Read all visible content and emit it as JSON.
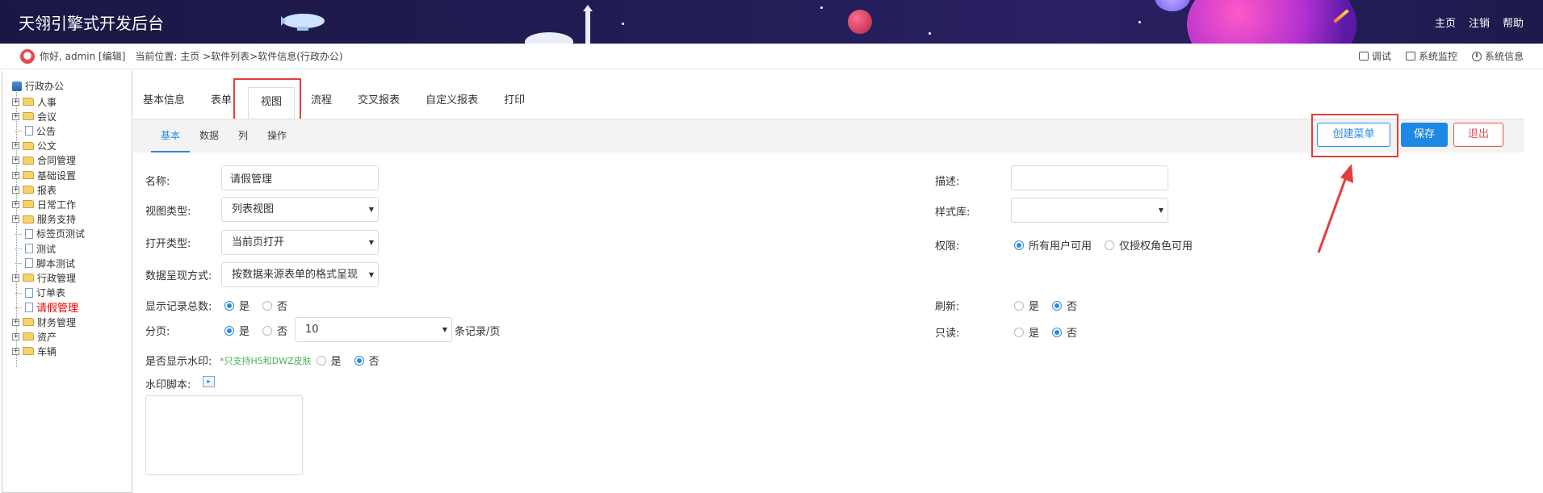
{
  "header": {
    "title": "天翎引擎式开发后台",
    "nav": [
      "主页",
      "注销",
      "帮助"
    ]
  },
  "subbar": {
    "greeting": "你好, admin [编辑]",
    "location": "当前位置: 主页 >软件列表>软件信息(行政办公)",
    "tools": [
      "调试",
      "系统监控",
      "系统信息"
    ]
  },
  "tree": {
    "root": "行政办公",
    "items": [
      {
        "label": "人事",
        "type": "folder"
      },
      {
        "label": "会议",
        "type": "folder"
      },
      {
        "label": "公告",
        "type": "doc"
      },
      {
        "label": "公文",
        "type": "folder"
      },
      {
        "label": "合同管理",
        "type": "folder"
      },
      {
        "label": "基础设置",
        "type": "folder"
      },
      {
        "label": "报表",
        "type": "folder"
      },
      {
        "label": "日常工作",
        "type": "folder"
      },
      {
        "label": "服务支持",
        "type": "folder"
      },
      {
        "label": "标签页测试",
        "type": "doc"
      },
      {
        "label": "测试",
        "type": "doc"
      },
      {
        "label": "脚本测试",
        "type": "doc"
      },
      {
        "label": "行政管理",
        "type": "folder"
      },
      {
        "label": "订单表",
        "type": "doc"
      },
      {
        "label": "请假管理",
        "type": "doc",
        "active": true
      },
      {
        "label": "财务管理",
        "type": "folder"
      },
      {
        "label": "资产",
        "type": "folder"
      },
      {
        "label": "车辆",
        "type": "folder"
      }
    ]
  },
  "tabs": [
    "基本信息",
    "表单",
    "视图",
    "流程",
    "交叉报表",
    "自定义报表",
    "打印"
  ],
  "subtabs": [
    "基本",
    "数据",
    "列",
    "操作"
  ],
  "buttons": {
    "create": "创建菜单",
    "save": "保存",
    "exit": "退出"
  },
  "form": {
    "name_label": "名称:",
    "name_value": "请假管理",
    "view_type_label": "视图类型:",
    "view_type_value": "列表视图",
    "open_type_label": "打开类型:",
    "open_type_value": "当前页打开",
    "present_label": "数据呈现方式:",
    "present_value": "按数据来源表单的格式呈现",
    "show_total_label": "显示记录总数:",
    "paging_label": "分页:",
    "page_size_value": "10",
    "page_size_suffix": "条记录/页",
    "watermark_label": "是否显示水印:",
    "watermark_hint": "*只支持H5和DWZ皮肤",
    "watermark_script_label": "水印脚本:",
    "desc_label": "描述:",
    "style_label": "样式库:",
    "perm_label": "权限:",
    "perm_all": "所有用户可用",
    "perm_role": "仅授权角色可用",
    "refresh_label": "刷新:",
    "readonly_label": "只读:",
    "yes": "是",
    "no": "否"
  }
}
